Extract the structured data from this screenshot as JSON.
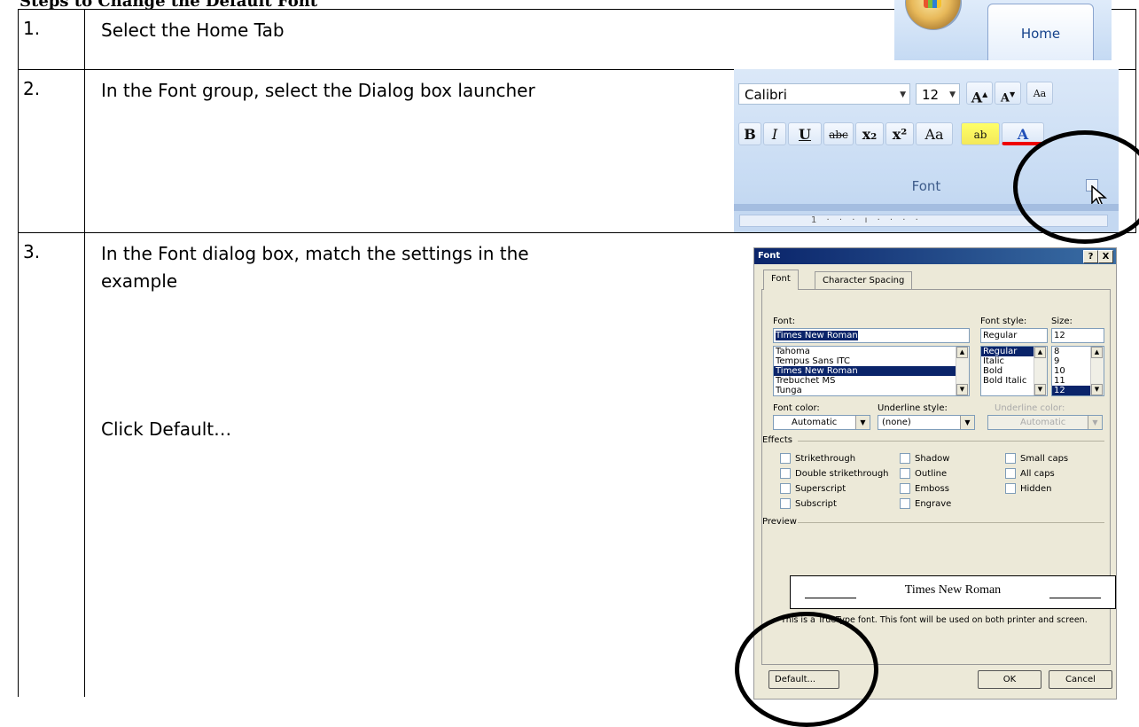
{
  "heading": "Steps to Change the Default Font",
  "steps": [
    {
      "number": "1.",
      "lines": [
        "Select the Home Tab"
      ]
    },
    {
      "number": "2.",
      "lines": [
        "In the Font group, select the Dialog box launcher"
      ]
    },
    {
      "number": "3.",
      "lines": [
        "In the Font dialog box, match the settings in the",
        "example"
      ],
      "extra": "Click Default…"
    }
  ],
  "home_image": {
    "tab_label": "Home"
  },
  "ribbon": {
    "font_name": "Calibri",
    "font_size": "12",
    "group_label": "Font",
    "buttons": {
      "grow": "A",
      "shrink": "A",
      "bold": "B",
      "italic": "I",
      "underline": "U",
      "strike": "abc",
      "subscript": "x₂",
      "superscript": "x²",
      "change_case": "Aa",
      "highlight": "ab",
      "font_color": "A"
    },
    "ruler_text": "1 · · · ı · · · ·"
  },
  "dialog": {
    "title": "Font",
    "title_buttons": [
      "?",
      "X"
    ],
    "tabs": [
      "Font",
      "Character Spacing"
    ],
    "font_label": "Font:",
    "font_value": "Times New Roman",
    "font_list": [
      "Tahoma",
      "Tempus Sans ITC",
      "Times New Roman",
      "Trebuchet MS",
      "Tunga"
    ],
    "font_selected_index": 2,
    "style_label": "Font style:",
    "style_value": "Regular",
    "style_list": [
      "Regular",
      "Italic",
      "Bold",
      "Bold Italic"
    ],
    "style_selected_index": 0,
    "size_label": "Size:",
    "size_value": "12",
    "size_list": [
      "8",
      "9",
      "10",
      "11",
      "12"
    ],
    "size_selected_index": 4,
    "font_color_label": "Font color:",
    "font_color_value": "Automatic",
    "underline_style_label": "Underline style:",
    "underline_style_value": "(none)",
    "underline_color_label": "Underline color:",
    "underline_color_value": "Automatic",
    "effects_label": "Effects",
    "effects": [
      [
        "Strikethrough",
        "Double strikethrough",
        "Superscript",
        "Subscript"
      ],
      [
        "Shadow",
        "Outline",
        "Emboss",
        "Engrave"
      ],
      [
        "Small caps",
        "All caps",
        "Hidden"
      ]
    ],
    "preview_label": "Preview",
    "preview_text": "Times New Roman",
    "info_text": "This is a TrueType font. This font will be used on both printer and screen.",
    "default_button": "Default...",
    "ok_button": "OK",
    "cancel_button": "Cancel"
  }
}
